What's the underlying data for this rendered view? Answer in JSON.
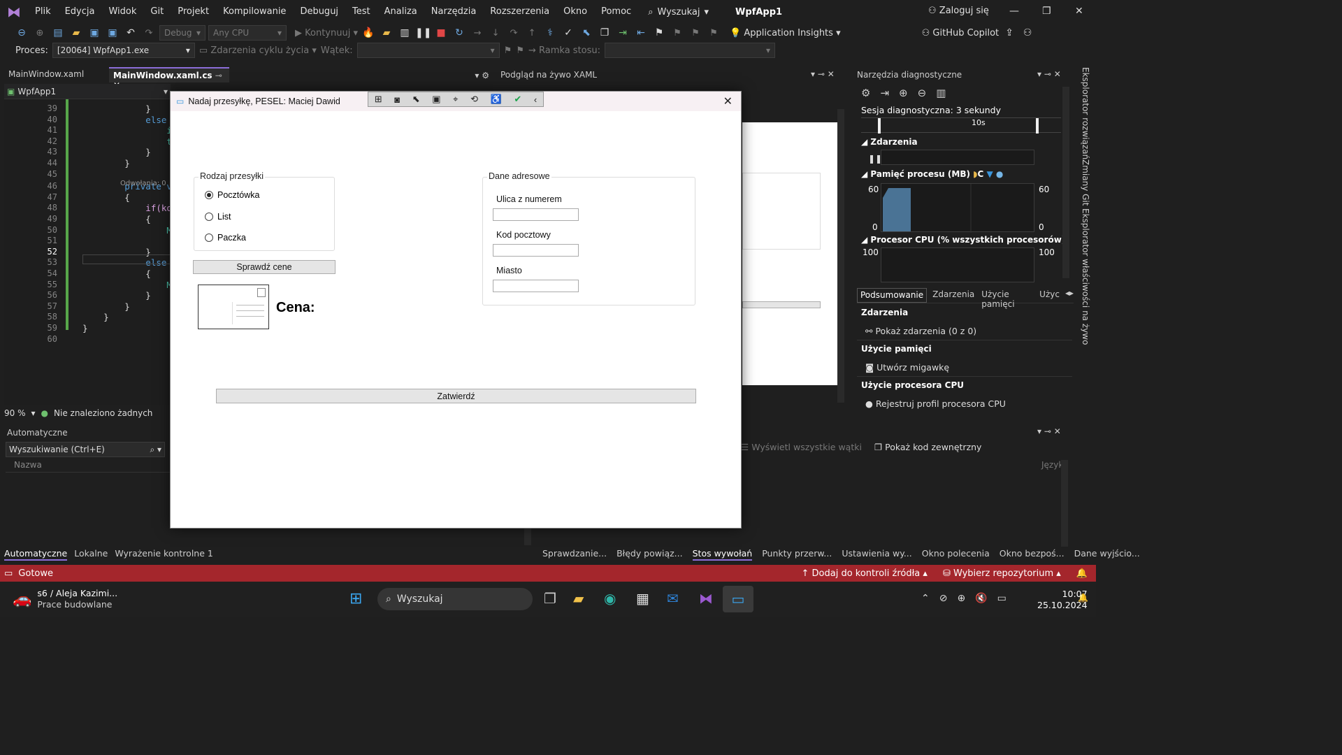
{
  "menu": {
    "items": [
      "Plik",
      "Edycja",
      "Widok",
      "Git",
      "Projekt",
      "Kompilowanie",
      "Debuguj",
      "Test",
      "Analiza",
      "Narzędzia",
      "Rozszerzenia",
      "Okno",
      "Pomoc"
    ],
    "search_label": "Wyszukaj",
    "app_title": "WpfApp1",
    "login_label": "Zaloguj się"
  },
  "toolbar": {
    "config": "Debug",
    "platform": "Any CPU",
    "continue_label": "Kontynuuj",
    "app_insights": "Application Insights",
    "copilot": "GitHub Copilot",
    "process_label": "Proces:",
    "process_value": "[20064] WpfApp1.exe",
    "lifecycle_label": "Zdarzenia cyklu życia",
    "thread_label": "Wątek:",
    "stack_frame_label": "Ramka stosu:"
  },
  "editor": {
    "tabs": [
      {
        "label": "MainWindow.xaml"
      },
      {
        "label": "MainWindow.xaml.cs"
      }
    ],
    "project_combo": "WpfApp1",
    "references_hint": "Odwołania: 0",
    "zoom": "90 %",
    "status_text": "Nie znaleziono żadnych",
    "lines": [
      {
        "num": "39",
        "text": "            }"
      },
      {
        "num": "40",
        "text": "            else i"
      },
      {
        "num": "41",
        "text": "                im"
      },
      {
        "num": "42",
        "text": "                te"
      },
      {
        "num": "43",
        "text": "            }"
      },
      {
        "num": "44",
        "text": "        }"
      },
      {
        "num": "45",
        "text": ""
      },
      {
        "num": "46",
        "text": "        private vo"
      },
      {
        "num": "47",
        "text": "        {"
      },
      {
        "num": "48",
        "text": "            if(kod"
      },
      {
        "num": "49",
        "text": "            {"
      },
      {
        "num": "50",
        "text": "                Me"
      },
      {
        "num": "51",
        "text": ""
      },
      {
        "num": "52",
        "text": "            }"
      },
      {
        "num": "53",
        "text": "            else"
      },
      {
        "num": "54",
        "text": "            {"
      },
      {
        "num": "55",
        "text": "                Me"
      },
      {
        "num": "56",
        "text": "            }"
      },
      {
        "num": "57",
        "text": "        }"
      },
      {
        "num": "58",
        "text": "    }"
      },
      {
        "num": "59",
        "text": "}"
      },
      {
        "num": "60",
        "text": ""
      }
    ]
  },
  "xaml_preview": {
    "title": "Podgląd na żywo XAML"
  },
  "diagnostics": {
    "title": "Narzędzia diagnostyczne",
    "session": "Sesja diagnostyczna: 3 sekundy",
    "timeline_tick": "10s",
    "events_header": "Zdarzenia",
    "memory_header": "Pamięć procesu (MB)",
    "memory_legend_c": "C",
    "memory_max": "60",
    "memory_min": "0",
    "cpu_header": "Procesor CPU (% wszystkich procesorów)",
    "cpu_max": "100",
    "tabs": [
      "Podsumowanie",
      "Zdarzenia",
      "Użycie pamięci",
      "Użyc"
    ],
    "summary": {
      "events_title": "Zdarzenia",
      "events_link": "Pokaż zdarzenia (0 z 0)",
      "memory_title": "Użycie pamięci",
      "memory_action": "Utwórz migawkę",
      "cpu_title": "Użycie procesora CPU",
      "cpu_action": "Rejestruj profil procesora CPU"
    }
  },
  "side_tabs": [
    "Eksplorator rozwiązań",
    "Zmiany Git",
    "Eksplorator właściwości na żywo"
  ],
  "bottom": {
    "autos_title": "Automatyczne",
    "search_placeholder": "Wyszukiwanie (Ctrl+E)",
    "column_name": "Nazwa",
    "column_lang": "Język",
    "show_threads": "Wyświetl wszystkie wątki",
    "show_external": "Pokaż kod zewnętrzny",
    "left_tabs": [
      "Automatyczne",
      "Lokalne",
      "Wyrażenie kontrolne 1"
    ],
    "right_tabs": [
      "Sprawdzanie...",
      "Błędy powiąz...",
      "Stos wywołań",
      "Punkty przerw...",
      "Ustawienia wy...",
      "Okno polecenia",
      "Okno bezpoś...",
      "Dane wyjścio..."
    ]
  },
  "statusbar": {
    "ready": "Gotowe",
    "add_source": "Dodaj do kontroli źródła",
    "select_repo": "Wybierz repozytorium"
  },
  "taskbar": {
    "weather_title": "s6 / Aleja Kazimi...",
    "weather_sub": "Prace budowlane",
    "search": "Wyszukaj",
    "time": "10:07",
    "date": "25.10.2024"
  },
  "dialog": {
    "title": "Nadaj przesyłkę, PESEL: Maciej Dawid",
    "type_group": "Rodzaj przesyłki",
    "options": [
      {
        "label": "Pocztówka",
        "checked": true
      },
      {
        "label": "List",
        "checked": false
      },
      {
        "label": "Paczka",
        "checked": false
      }
    ],
    "check_price_button": "Sprawdź cene",
    "price_label": "Cena:",
    "address_group": "Dane adresowe",
    "street_label": "Ulica z numerem",
    "postal_label": "Kod pocztowy",
    "city_label": "Miasto",
    "confirm_button": "Zatwierdź"
  }
}
